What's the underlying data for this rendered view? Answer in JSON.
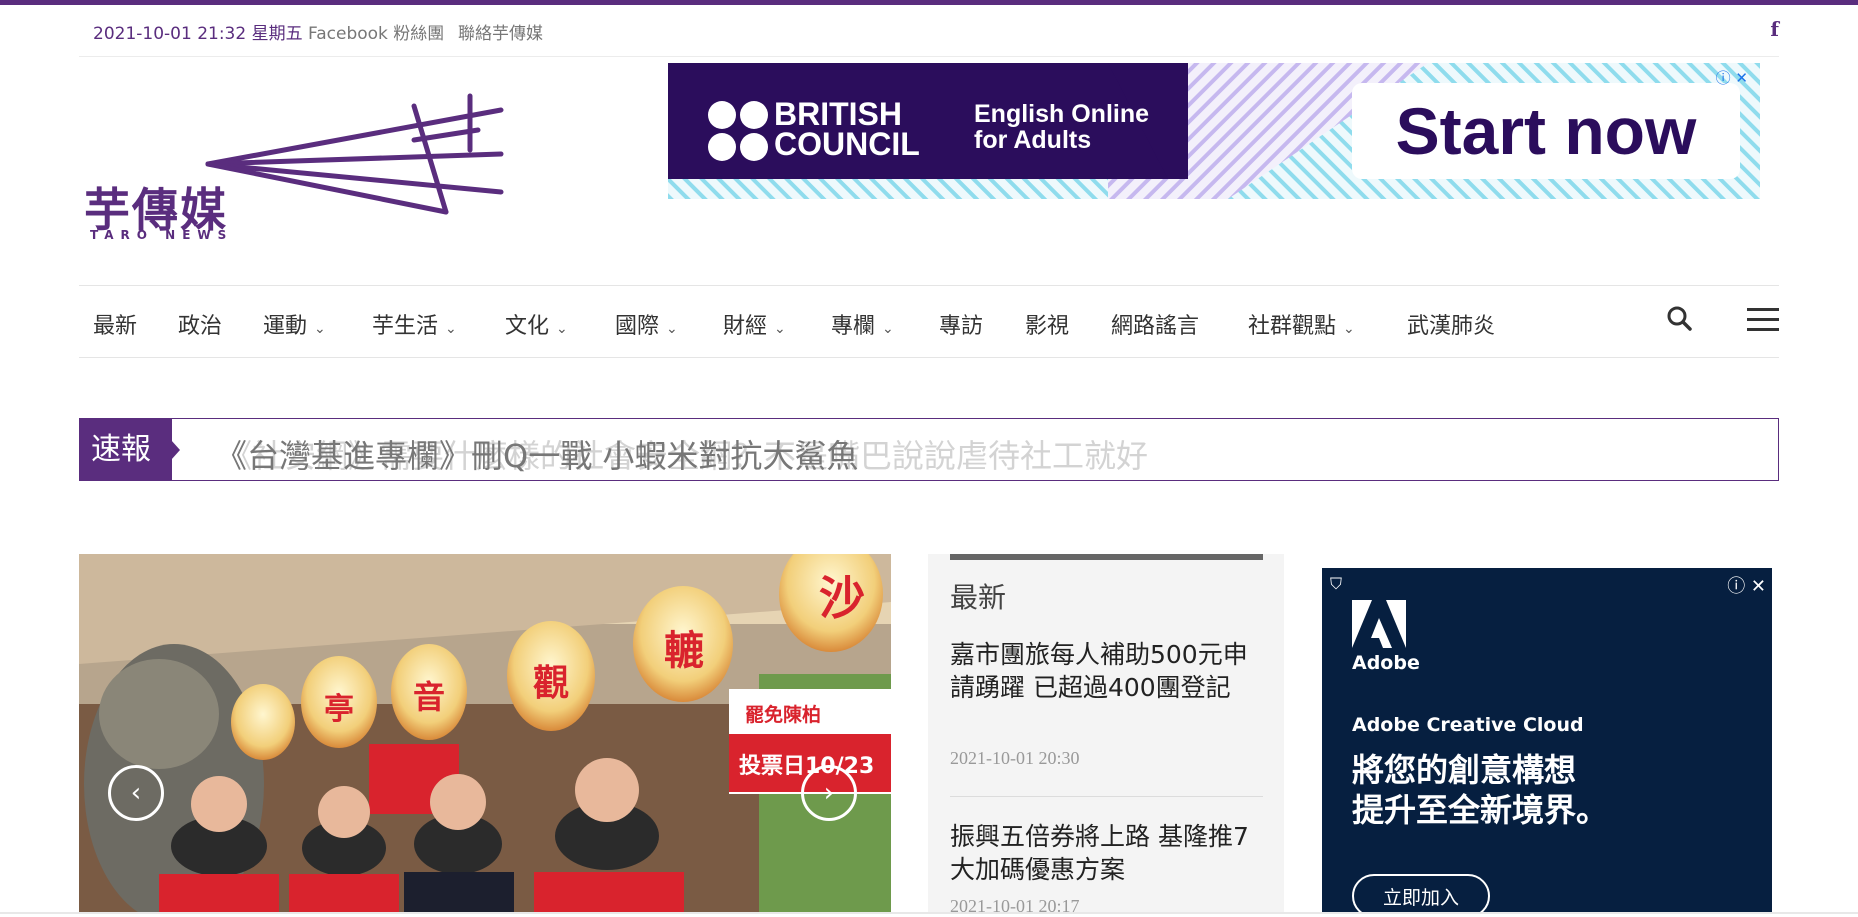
{
  "topbar": {
    "datetime": "2021-10-01 21:32 星期五",
    "links": [
      "Facebook 粉絲團",
      "聯絡芋傳媒"
    ],
    "social_icon": "facebook-icon"
  },
  "logo": {
    "name": "芋傳媒",
    "subtitle": "TARO NEWS",
    "color": "#5a2d7e"
  },
  "top_ad": {
    "brand_line1": "BRITISH",
    "brand_line2": "COUNCIL",
    "tagline_line1": "English Online",
    "tagline_line2": "for Adults",
    "cta": "Start now"
  },
  "nav": {
    "items": [
      {
        "label": "最新"
      },
      {
        "label": "政治"
      },
      {
        "label": "運動",
        "dropdown": true
      },
      {
        "label": "芋生活",
        "dropdown": true
      },
      {
        "label": "文化",
        "dropdown": true
      },
      {
        "label": "國際",
        "dropdown": true
      },
      {
        "label": "財經",
        "dropdown": true
      },
      {
        "label": "專欄",
        "dropdown": true
      },
      {
        "label": "專訪"
      },
      {
        "label": "影視"
      },
      {
        "label": "網路謠言"
      },
      {
        "label": "社群觀點",
        "dropdown": true
      },
      {
        "label": "武漢肺炎"
      }
    ],
    "caret": "⌄",
    "search_icon": "search-icon",
    "menu_icon": "hamburger-menu-icon"
  },
  "ticker": {
    "label": "速報",
    "headline": "《台灣基進專欄》刪Q一戰 小蝦米對抗大鯊魚",
    "fading_headline": "《社安網》需要什麼樣的社會安全網？不是嘴巴說說虐待社工就好"
  },
  "slider": {
    "prev_icon": "‹",
    "next_icon": "›",
    "lantern_chars": [
      "沙",
      "轆",
      "觀",
      "音",
      "亭"
    ],
    "sign_text": "罷免陳柏",
    "sign_date": "投票日10/23"
  },
  "latest": {
    "title": "最新",
    "items": [
      {
        "title": "嘉市團旅每人補助500元申請踴躍 已超過400團登記",
        "time": "2021-10-01 20:30"
      },
      {
        "title": "振興五倍券將上路 基隆推7大加碼優惠方案",
        "time": "2021-10-01 20:17"
      }
    ]
  },
  "side_ad": {
    "brand": "Adobe",
    "product": "Adobe Creative Cloud",
    "headline_line1": "將您的創意構想",
    "headline_line2": "提升至全新境界。",
    "cta": "立即加入"
  },
  "colors": {
    "brand": "#5a2d7e",
    "ad_dark": "#2b0d5c",
    "ad_cta_text": "#2b0d5c",
    "adobe_bg": "#061f40"
  }
}
